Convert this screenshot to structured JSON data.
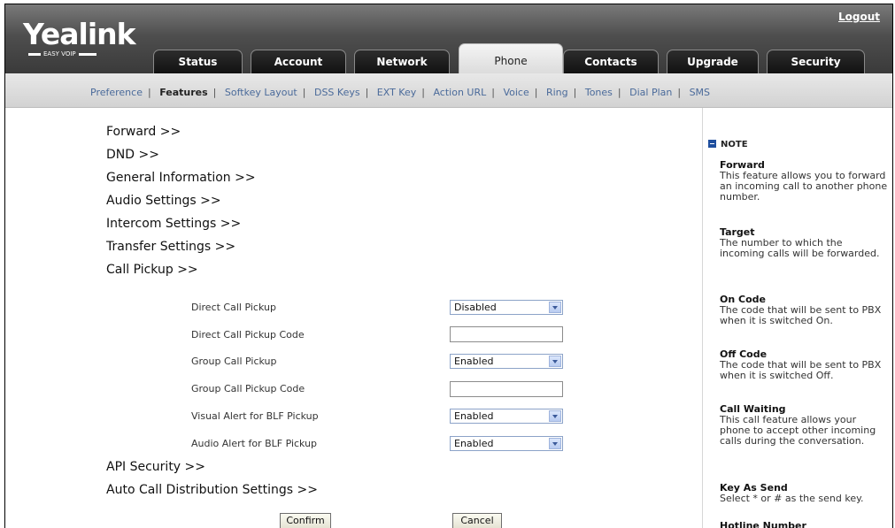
{
  "header": {
    "logo": "Yealink",
    "logo_sub": "EASY VOIP",
    "logout": "Logout"
  },
  "tabs": [
    {
      "label": "Status"
    },
    {
      "label": "Account"
    },
    {
      "label": "Network"
    },
    {
      "label": "Phone"
    },
    {
      "label": "Contacts"
    },
    {
      "label": "Upgrade"
    },
    {
      "label": "Security"
    }
  ],
  "subnav": [
    {
      "label": "Preference"
    },
    {
      "label": "Features"
    },
    {
      "label": "Softkey Layout"
    },
    {
      "label": "DSS Keys"
    },
    {
      "label": "EXT Key"
    },
    {
      "label": "Action URL"
    },
    {
      "label": "Voice"
    },
    {
      "label": "Ring"
    },
    {
      "label": "Tones"
    },
    {
      "label": "Dial Plan"
    },
    {
      "label": "SMS"
    }
  ],
  "sections": {
    "forward": "Forward >>",
    "dnd": "DND >>",
    "general": "General Information >>",
    "audio": "Audio Settings >>",
    "intercom": "Intercom Settings >>",
    "transfer": "Transfer Settings >>",
    "pickup": "Call Pickup >>",
    "api": "API Security >>",
    "acd": "Auto Call Distribution Settings >>"
  },
  "pickup": {
    "direct_label": "Direct Call Pickup",
    "direct_value": "Disabled",
    "direct_code_label": "Direct Call Pickup Code",
    "direct_code_value": "",
    "group_label": "Group Call Pickup",
    "group_value": "Enabled",
    "group_code_label": "Group Call Pickup Code",
    "group_code_value": "",
    "visual_label": "Visual Alert for BLF Pickup",
    "visual_value": "Enabled",
    "audio_label": "Audio Alert for BLF Pickup",
    "audio_value": "Enabled"
  },
  "buttons": {
    "confirm": "Confirm",
    "cancel": "Cancel"
  },
  "note": {
    "heading": "NOTE",
    "items": [
      {
        "title": "Forward",
        "desc": "This feature allows you to forward an incoming call to another phone number."
      },
      {
        "title": "Target",
        "desc": "The number to which the incoming calls will be forwarded."
      },
      {
        "title": "On Code",
        "desc": "The code that will be sent to PBX when it is switched On."
      },
      {
        "title": "Off Code",
        "desc": "The code that will be sent to PBX when it is switched Off."
      },
      {
        "title": "Call Waiting",
        "desc": "This call feature allows your phone to accept other incoming calls during the conversation."
      },
      {
        "title": "Key As Send",
        "desc": "Select * or # as the send key."
      },
      {
        "title": "Hotline Number",
        "desc": ""
      }
    ]
  },
  "colors": {
    "header_dark": "#3a3a3a",
    "subnav_link": "#4a6a9a",
    "note_icon": "#1f4e9e"
  }
}
